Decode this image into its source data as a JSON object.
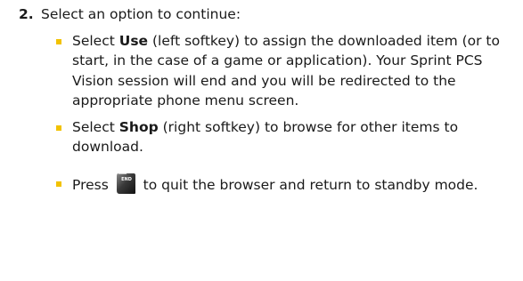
{
  "step": {
    "number": "2.",
    "text": "Select an option to continue:"
  },
  "bullets": [
    {
      "prefix": "Select ",
      "bold": "Use",
      "suffix": " (left softkey) to assign the downloaded item (or to start, in the case of a game or application). Your Sprint PCS Vision session will end and you will be redirected to the appropriate phone menu screen."
    },
    {
      "prefix": "Select ",
      "bold": "Shop",
      "suffix": " (right softkey) to browse for other items to download."
    },
    {
      "prefix": "Press ",
      "icon": "end-key-icon",
      "icon_label": "END",
      "suffix": " to quit the browser and return to standby mode."
    }
  ],
  "colors": {
    "bullet": "#f2c200",
    "text": "#1a1a1a"
  }
}
